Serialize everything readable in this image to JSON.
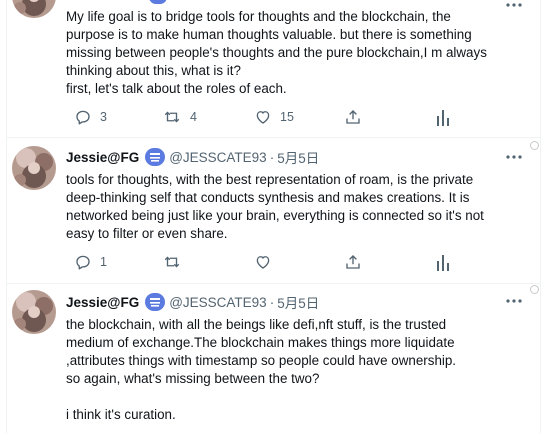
{
  "tweets": [
    {
      "lines": [
        "My life goal is to bridge tools for thoughts and the blockchain, the",
        "purpose is to make human thoughts valuable. but there is something",
        "missing between people's thoughts and the pure blockchain,I m always",
        "thinking about this, what is it?",
        "first, let's talk about the roles of each."
      ],
      "reply_count": "3",
      "retweet_count": "4",
      "like_count": "15"
    },
    {
      "name": "Jessie@FG",
      "handle": "@JESSCATE93",
      "separator": "·",
      "date": "5月5日",
      "lines": [
        "tools for thoughts, with the best representation of roam, is the private",
        "deep-thinking self that conducts synthesis and makes creations. It is",
        "networked being just like your brain, everything is connected so it's not",
        "easy to filter or even share."
      ],
      "reply_count": "1",
      "retweet_count": "",
      "like_count": ""
    },
    {
      "name": "Jessie@FG",
      "handle": "@JESSCATE93",
      "separator": "·",
      "date": "5月5日",
      "lines": [
        "the blockchain, with all the beings like defi,nft stuff, is the trusted",
        "medium of exchange.The blockchain makes things more liquidate",
        ",attributes things with timestamp so people could have ownership.",
        "so again, what's missing between the two?",
        "",
        "i think it's curation."
      ]
    }
  ],
  "icons": {
    "reply": "reply-icon",
    "retweet": "retweet-icon",
    "like": "heart-icon",
    "share": "share-icon",
    "analytics": "analytics-icon",
    "more": "more-icon",
    "badge": "verified-badge-icon"
  },
  "colors": {
    "text": "#0f1419",
    "secondary": "#536471",
    "divider": "#eff3f4",
    "badge": "#5b7be0"
  }
}
